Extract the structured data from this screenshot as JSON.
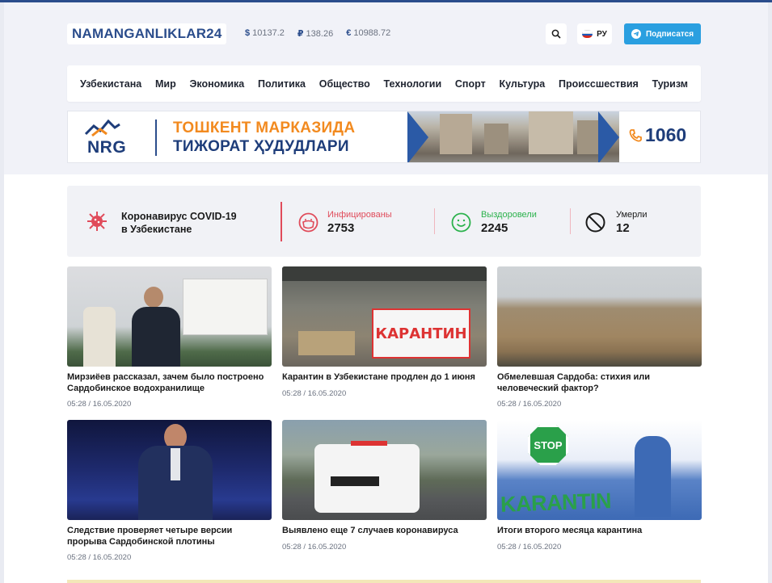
{
  "header": {
    "logo": "NAMANGANLIKLAR24",
    "rates": [
      {
        "symbol": "$",
        "value": "10137.2"
      },
      {
        "symbol": "₽",
        "value": "138.26"
      },
      {
        "symbol": "€",
        "value": "10988.72"
      }
    ],
    "lang": "РУ",
    "subscribe": "Подписатся"
  },
  "nav": [
    "Узбекистана",
    "Мир",
    "Экономика",
    "Политика",
    "Общество",
    "Технологии",
    "Спорт",
    "Культура",
    "Происсшествия",
    "Туризм"
  ],
  "banner": {
    "brand": "NRG",
    "line1": "ТОШКЕНТ МАРКАЗИДА",
    "line2": "ТИЖОРАТ ҲУДУДЛАРИ",
    "phone": "1060"
  },
  "covid": {
    "title_line1": "Коронавирус COVID-19",
    "title_line2": "в Узбекистане",
    "stats": [
      {
        "label": "Инфицированы",
        "value": "2753",
        "color": "#e04b5a",
        "icon": "mask-face-icon"
      },
      {
        "label": "Выздоровели",
        "value": "2245",
        "color": "#2bb24c",
        "icon": "smile-face-icon"
      },
      {
        "label": "Умерли",
        "value": "12",
        "color": "#1a1a1a",
        "icon": "prohibited-icon"
      }
    ]
  },
  "news": [
    {
      "title": "Мирзиёев рассказал, зачем было построено Сардобинское водохранилище",
      "date": "05:28 / 16.05.2020"
    },
    {
      "title": "Карантин в Узбекистане продлен до 1 июня",
      "date": "05:28 / 16.05.2020",
      "sign": "КАРАНТИН"
    },
    {
      "title": "Обмелевшая Сардоба: стихия или человеческий фактор?",
      "date": "05:28 / 16.05.2020"
    },
    {
      "title": "Следствие проверяет четыре версии прорыва Сардобинской плотины",
      "date": "05:28 / 16.05.2020"
    },
    {
      "title": "Выявлено еще 7 случаев коронавируса",
      "date": "05:28 / 16.05.2020"
    },
    {
      "title": "Итоги второго месяца карантина",
      "date": "05:28 / 16.05.2020",
      "sign_stop": "STOP",
      "sign": "KARANTIN"
    }
  ]
}
